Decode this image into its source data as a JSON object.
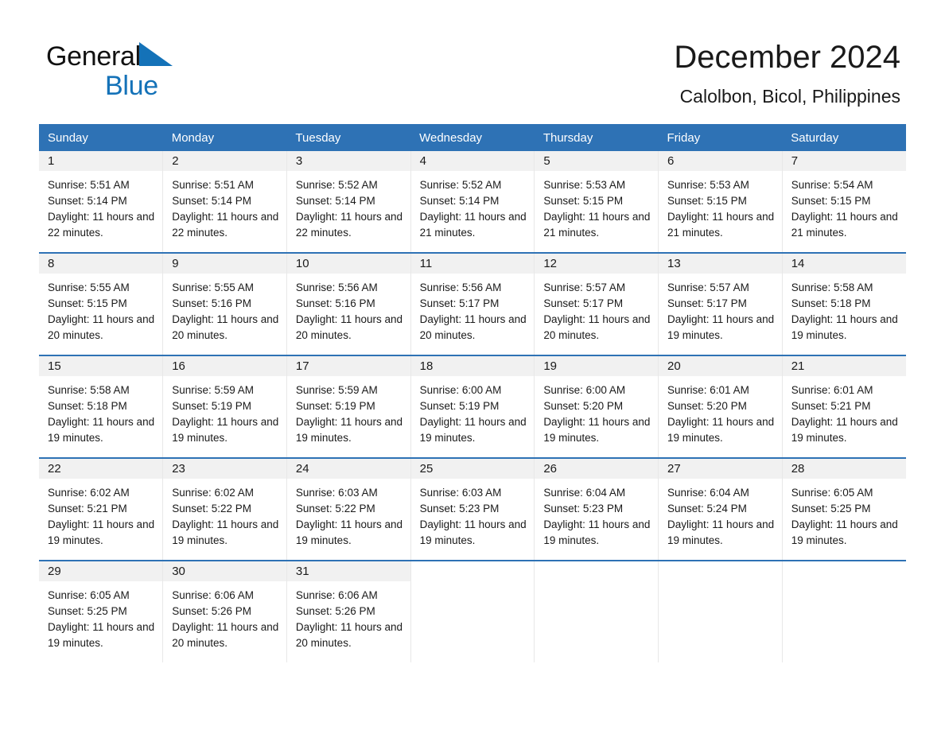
{
  "brand": {
    "name_part1": "General",
    "name_part2": "Blue",
    "accent_color": "#1472b8"
  },
  "header": {
    "title": "December 2024",
    "location": "Calolbon, Bicol, Philippines"
  },
  "calendar": {
    "header_color": "#2e72b5",
    "daynum_band_color": "#f1f1f1",
    "weekdays": [
      "Sunday",
      "Monday",
      "Tuesday",
      "Wednesday",
      "Thursday",
      "Friday",
      "Saturday"
    ],
    "weeks": [
      [
        {
          "day": "1",
          "sunrise": "Sunrise: 5:51 AM",
          "sunset": "Sunset: 5:14 PM",
          "daylight": "Daylight: 11 hours and 22 minutes."
        },
        {
          "day": "2",
          "sunrise": "Sunrise: 5:51 AM",
          "sunset": "Sunset: 5:14 PM",
          "daylight": "Daylight: 11 hours and 22 minutes."
        },
        {
          "day": "3",
          "sunrise": "Sunrise: 5:52 AM",
          "sunset": "Sunset: 5:14 PM",
          "daylight": "Daylight: 11 hours and 22 minutes."
        },
        {
          "day": "4",
          "sunrise": "Sunrise: 5:52 AM",
          "sunset": "Sunset: 5:14 PM",
          "daylight": "Daylight: 11 hours and 21 minutes."
        },
        {
          "day": "5",
          "sunrise": "Sunrise: 5:53 AM",
          "sunset": "Sunset: 5:15 PM",
          "daylight": "Daylight: 11 hours and 21 minutes."
        },
        {
          "day": "6",
          "sunrise": "Sunrise: 5:53 AM",
          "sunset": "Sunset: 5:15 PM",
          "daylight": "Daylight: 11 hours and 21 minutes."
        },
        {
          "day": "7",
          "sunrise": "Sunrise: 5:54 AM",
          "sunset": "Sunset: 5:15 PM",
          "daylight": "Daylight: 11 hours and 21 minutes."
        }
      ],
      [
        {
          "day": "8",
          "sunrise": "Sunrise: 5:55 AM",
          "sunset": "Sunset: 5:15 PM",
          "daylight": "Daylight: 11 hours and 20 minutes."
        },
        {
          "day": "9",
          "sunrise": "Sunrise: 5:55 AM",
          "sunset": "Sunset: 5:16 PM",
          "daylight": "Daylight: 11 hours and 20 minutes."
        },
        {
          "day": "10",
          "sunrise": "Sunrise: 5:56 AM",
          "sunset": "Sunset: 5:16 PM",
          "daylight": "Daylight: 11 hours and 20 minutes."
        },
        {
          "day": "11",
          "sunrise": "Sunrise: 5:56 AM",
          "sunset": "Sunset: 5:17 PM",
          "daylight": "Daylight: 11 hours and 20 minutes."
        },
        {
          "day": "12",
          "sunrise": "Sunrise: 5:57 AM",
          "sunset": "Sunset: 5:17 PM",
          "daylight": "Daylight: 11 hours and 20 minutes."
        },
        {
          "day": "13",
          "sunrise": "Sunrise: 5:57 AM",
          "sunset": "Sunset: 5:17 PM",
          "daylight": "Daylight: 11 hours and 19 minutes."
        },
        {
          "day": "14",
          "sunrise": "Sunrise: 5:58 AM",
          "sunset": "Sunset: 5:18 PM",
          "daylight": "Daylight: 11 hours and 19 minutes."
        }
      ],
      [
        {
          "day": "15",
          "sunrise": "Sunrise: 5:58 AM",
          "sunset": "Sunset: 5:18 PM",
          "daylight": "Daylight: 11 hours and 19 minutes."
        },
        {
          "day": "16",
          "sunrise": "Sunrise: 5:59 AM",
          "sunset": "Sunset: 5:19 PM",
          "daylight": "Daylight: 11 hours and 19 minutes."
        },
        {
          "day": "17",
          "sunrise": "Sunrise: 5:59 AM",
          "sunset": "Sunset: 5:19 PM",
          "daylight": "Daylight: 11 hours and 19 minutes."
        },
        {
          "day": "18",
          "sunrise": "Sunrise: 6:00 AM",
          "sunset": "Sunset: 5:19 PM",
          "daylight": "Daylight: 11 hours and 19 minutes."
        },
        {
          "day": "19",
          "sunrise": "Sunrise: 6:00 AM",
          "sunset": "Sunset: 5:20 PM",
          "daylight": "Daylight: 11 hours and 19 minutes."
        },
        {
          "day": "20",
          "sunrise": "Sunrise: 6:01 AM",
          "sunset": "Sunset: 5:20 PM",
          "daylight": "Daylight: 11 hours and 19 minutes."
        },
        {
          "day": "21",
          "sunrise": "Sunrise: 6:01 AM",
          "sunset": "Sunset: 5:21 PM",
          "daylight": "Daylight: 11 hours and 19 minutes."
        }
      ],
      [
        {
          "day": "22",
          "sunrise": "Sunrise: 6:02 AM",
          "sunset": "Sunset: 5:21 PM",
          "daylight": "Daylight: 11 hours and 19 minutes."
        },
        {
          "day": "23",
          "sunrise": "Sunrise: 6:02 AM",
          "sunset": "Sunset: 5:22 PM",
          "daylight": "Daylight: 11 hours and 19 minutes."
        },
        {
          "day": "24",
          "sunrise": "Sunrise: 6:03 AM",
          "sunset": "Sunset: 5:22 PM",
          "daylight": "Daylight: 11 hours and 19 minutes."
        },
        {
          "day": "25",
          "sunrise": "Sunrise: 6:03 AM",
          "sunset": "Sunset: 5:23 PM",
          "daylight": "Daylight: 11 hours and 19 minutes."
        },
        {
          "day": "26",
          "sunrise": "Sunrise: 6:04 AM",
          "sunset": "Sunset: 5:23 PM",
          "daylight": "Daylight: 11 hours and 19 minutes."
        },
        {
          "day": "27",
          "sunrise": "Sunrise: 6:04 AM",
          "sunset": "Sunset: 5:24 PM",
          "daylight": "Daylight: 11 hours and 19 minutes."
        },
        {
          "day": "28",
          "sunrise": "Sunrise: 6:05 AM",
          "sunset": "Sunset: 5:25 PM",
          "daylight": "Daylight: 11 hours and 19 minutes."
        }
      ],
      [
        {
          "day": "29",
          "sunrise": "Sunrise: 6:05 AM",
          "sunset": "Sunset: 5:25 PM",
          "daylight": "Daylight: 11 hours and 19 minutes."
        },
        {
          "day": "30",
          "sunrise": "Sunrise: 6:06 AM",
          "sunset": "Sunset: 5:26 PM",
          "daylight": "Daylight: 11 hours and 20 minutes."
        },
        {
          "day": "31",
          "sunrise": "Sunrise: 6:06 AM",
          "sunset": "Sunset: 5:26 PM",
          "daylight": "Daylight: 11 hours and 20 minutes."
        },
        {
          "day": "",
          "sunrise": "",
          "sunset": "",
          "daylight": ""
        },
        {
          "day": "",
          "sunrise": "",
          "sunset": "",
          "daylight": ""
        },
        {
          "day": "",
          "sunrise": "",
          "sunset": "",
          "daylight": ""
        },
        {
          "day": "",
          "sunrise": "",
          "sunset": "",
          "daylight": ""
        }
      ]
    ]
  }
}
